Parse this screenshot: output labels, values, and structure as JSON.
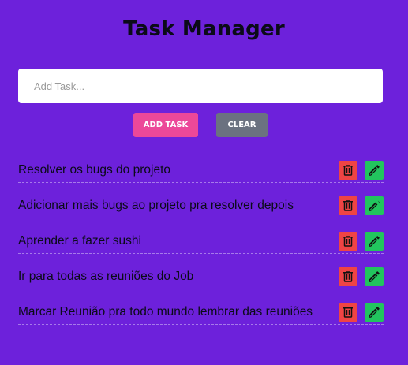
{
  "header": {
    "title": "Task Manager"
  },
  "input": {
    "placeholder": "Add Task...",
    "value": ""
  },
  "buttons": {
    "add_label": "ADD TASK",
    "clear_label": "CLEAR"
  },
  "tasks": [
    {
      "text": "Resolver os bugs do projeto"
    },
    {
      "text": "Adicionar mais bugs ao projeto pra resolver depois"
    },
    {
      "text": "Aprender a fazer sushi"
    },
    {
      "text": "Ir para todas as reuniões do Job"
    },
    {
      "text": "Marcar Reunião pra todo mundo lembrar das reuniões"
    }
  ],
  "icons": {
    "delete": "trash-icon",
    "edit": "pencil-icon"
  },
  "colors": {
    "background": "#6d21db",
    "add_button": "#ec4899",
    "clear_button": "#6b7280",
    "delete_button": "#ef4444",
    "edit_button": "#22c55e"
  }
}
